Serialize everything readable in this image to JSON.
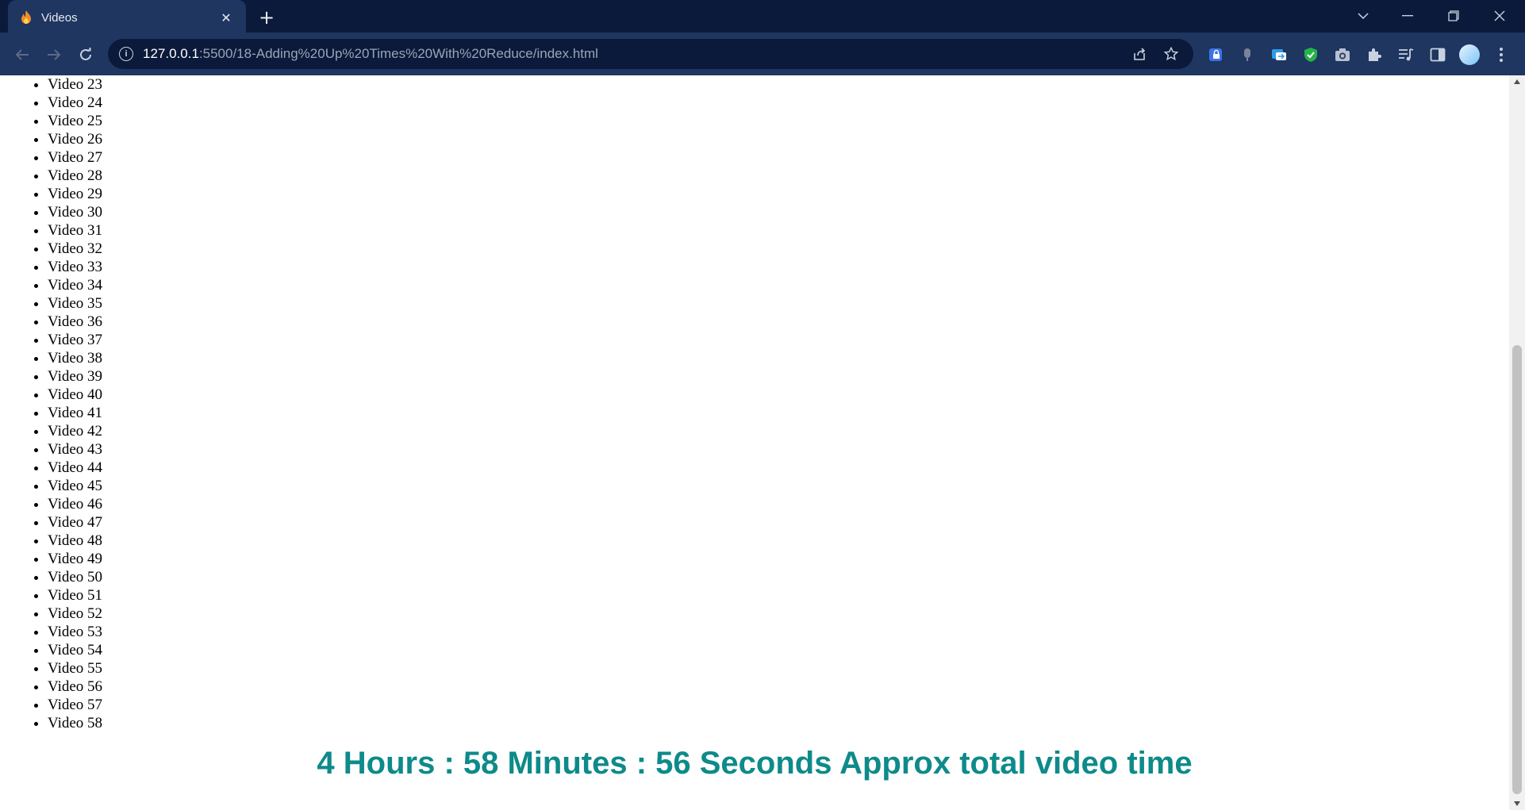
{
  "tab": {
    "title": "Videos",
    "close_glyph": "✕",
    "new_tab_glyph": "+"
  },
  "window_controls": {
    "tab_search": "⌄",
    "minimize": "—",
    "restore": "❐",
    "close": "✕"
  },
  "address_bar": {
    "host": "127.0.0.1",
    "path": ":5500/18-Adding%20Up%20Times%20With%20Reduce/index.html"
  },
  "icons": {
    "favicon": "flame-icon",
    "info": "info-icon",
    "share": "share-icon",
    "bookmark": "star-icon",
    "extensions": [
      "shield-lock-icon",
      "mic-icon",
      "translate-icon",
      "adblock-shield-icon",
      "camera-icon",
      "puzzle-icon",
      "media-queue-icon",
      "side-panel-icon"
    ],
    "profile": "avatar-icon",
    "menu": "kebab-menu-icon"
  },
  "colors": {
    "total_time": "#0e8a8a",
    "titlebar": "#0b1a3a",
    "toolbar": "#1e3660"
  },
  "videos": [
    "Video 23",
    "Video 24",
    "Video 25",
    "Video 26",
    "Video 27",
    "Video 28",
    "Video 29",
    "Video 30",
    "Video 31",
    "Video 32",
    "Video 33",
    "Video 34",
    "Video 35",
    "Video 36",
    "Video 37",
    "Video 38",
    "Video 39",
    "Video 40",
    "Video 41",
    "Video 42",
    "Video 43",
    "Video 44",
    "Video 45",
    "Video 46",
    "Video 47",
    "Video 48",
    "Video 49",
    "Video 50",
    "Video 51",
    "Video 52",
    "Video 53",
    "Video 54",
    "Video 55",
    "Video 56",
    "Video 57",
    "Video 58"
  ],
  "total_time_text": "4 Hours : 58 Minutes : 56 Seconds Approx total video time",
  "scrollbar": {
    "up_glyph": "▲",
    "down_glyph": "▼"
  }
}
